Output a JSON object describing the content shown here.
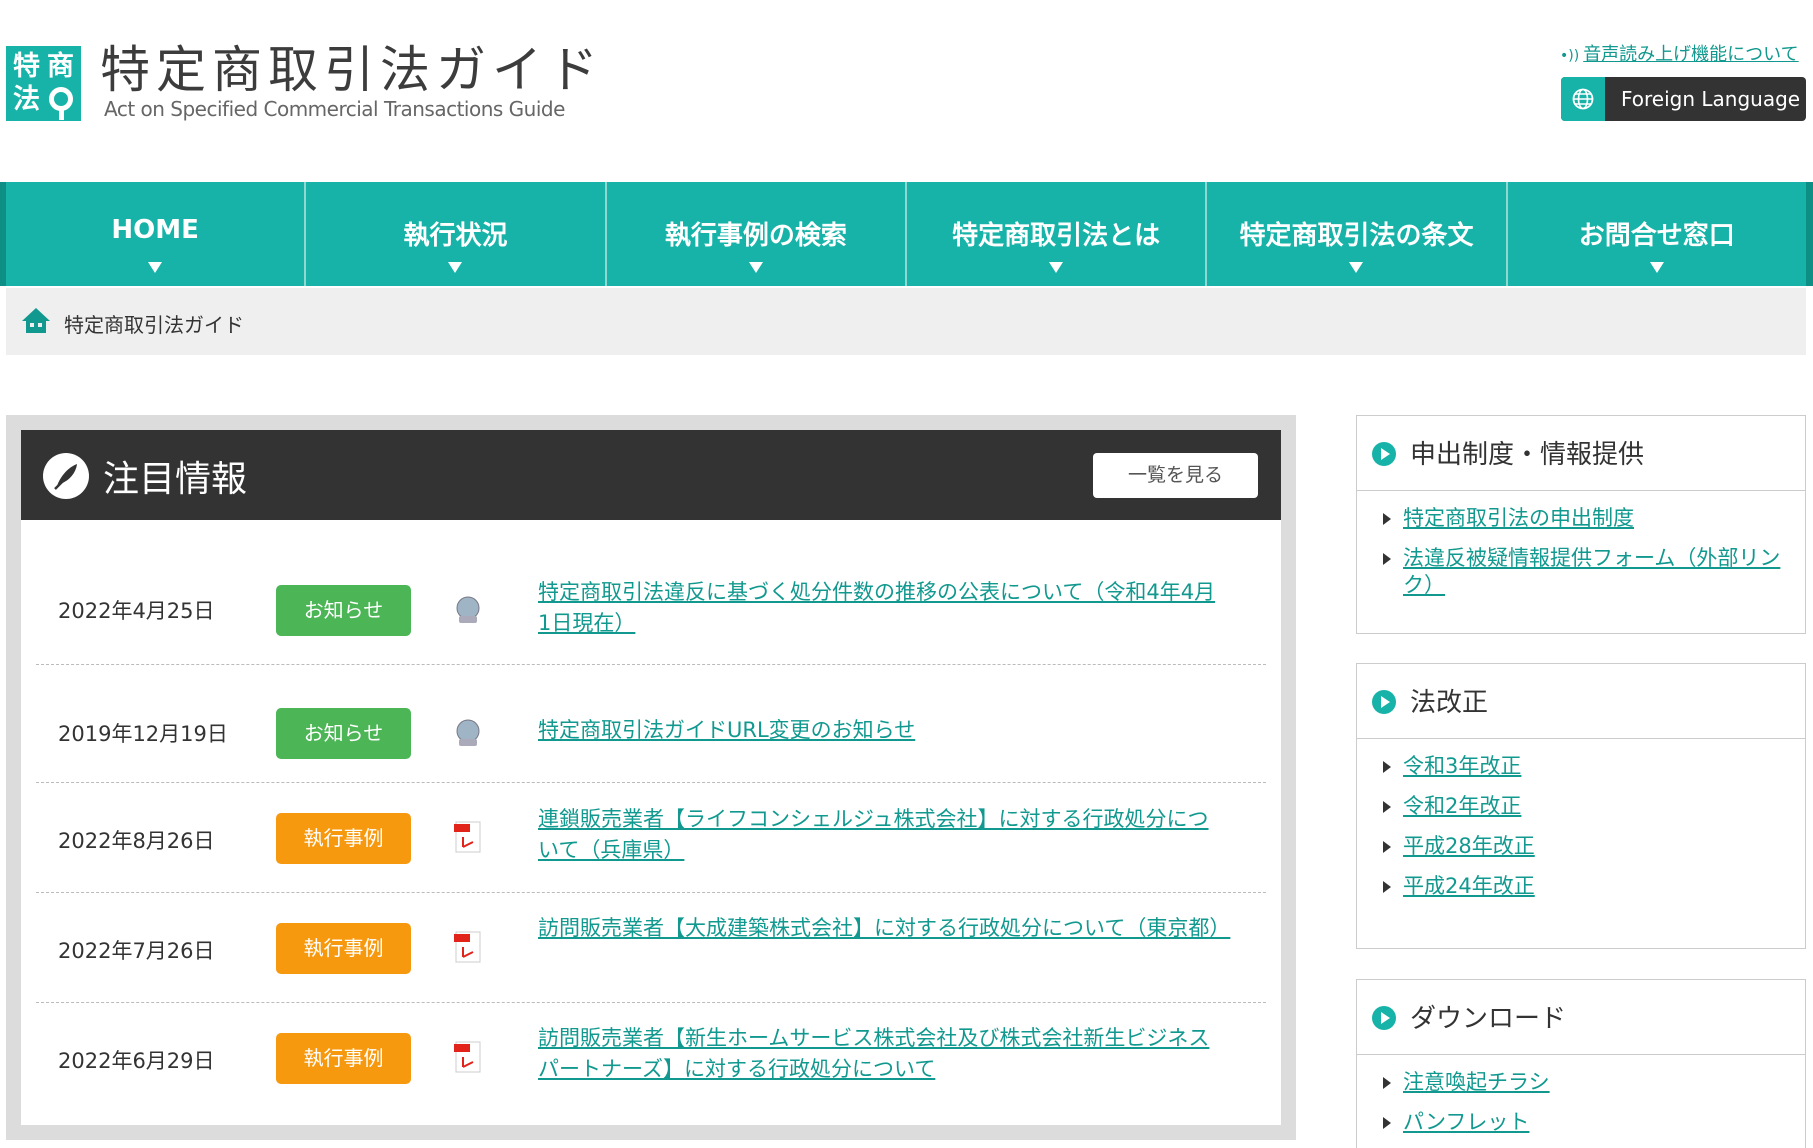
{
  "header": {
    "logo_chars": [
      "特",
      "商",
      "法"
    ],
    "title": "特定商取引法ガイド",
    "subtitle": "Act on Specified Commercial Transactions Guide",
    "speech_link": "音声読み上げ機能について",
    "foreign_button": "Foreign Language"
  },
  "nav": [
    {
      "label": "HOME"
    },
    {
      "label": "執行状況"
    },
    {
      "label": "執行事例の検索"
    },
    {
      "label": "特定商取引法とは"
    },
    {
      "label": "特定商取引法の条文"
    },
    {
      "label": "お問合せ窓口"
    }
  ],
  "breadcrumb": {
    "current": "特定商取引法ガイド"
  },
  "featured": {
    "title": "注目情報",
    "view_all": "一覧を見る",
    "items": [
      {
        "date": "2022年4月25日",
        "category": "お知らせ",
        "category_color": "#4cb556",
        "icon": "web-page-icon",
        "title": "特定商取引法違反に基づく処分件数の推移の公表について（令和4年4月1日現在）"
      },
      {
        "date": "2019年12月19日",
        "category": "お知らせ",
        "category_color": "#4cb556",
        "icon": "web-page-icon",
        "title": "特定商取引法ガイドURL変更のお知らせ"
      },
      {
        "date": "2022年8月26日",
        "category": "執行事例",
        "category_color": "#f7990e",
        "icon": "pdf-icon",
        "title": "連鎖販売業者【ライフコンシェルジュ株式会社】に対する行政処分について（兵庫県）"
      },
      {
        "date": "2022年7月26日",
        "category": "執行事例",
        "category_color": "#f7990e",
        "icon": "pdf-icon",
        "title": "訪問販売業者【大成建築株式会社】に対する行政処分について（東京都）"
      },
      {
        "date": "2022年6月29日",
        "category": "執行事例",
        "category_color": "#f7990e",
        "icon": "pdf-icon",
        "title": "訪問販売業者【新生ホームサービス株式会社及び株式会社新生ビジネスパートナーズ】に対する行政処分について"
      }
    ]
  },
  "sidebar": [
    {
      "title": "申出制度・情報提供",
      "links": [
        "特定商取引法の申出制度",
        "法違反被疑情報提供フォーム（外部リンク）"
      ]
    },
    {
      "title": "法改正",
      "links": [
        "令和3年改正",
        "令和2年改正",
        "平成28年改正",
        "平成24年改正"
      ]
    },
    {
      "title": "ダウンロード",
      "links": [
        "注意喚起チラシ",
        "パンフレット"
      ]
    }
  ],
  "colors": {
    "brand": "#17b3a8",
    "dark": "#333333",
    "link": "#12998f"
  }
}
